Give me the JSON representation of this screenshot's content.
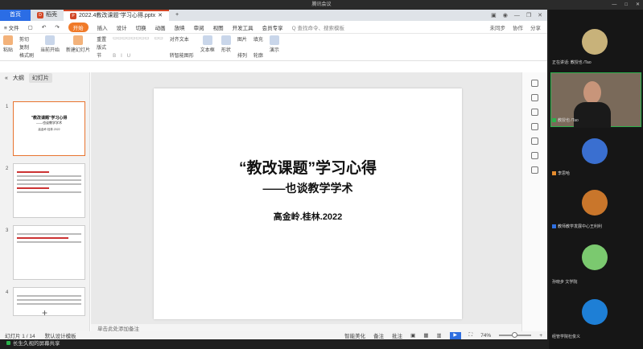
{
  "window": {
    "title": "腾讯会议",
    "controls": [
      "—",
      "□",
      "✕"
    ]
  },
  "tabs": {
    "home": "首页",
    "wps": "稻壳",
    "file": "2022.4教改课题\"学习心得.pptx",
    "add": "+"
  },
  "menu": {
    "file": "≡ 文件",
    "items": [
      "开始",
      "插入",
      "设计",
      "切换",
      "动画",
      "放映",
      "审阅",
      "视图",
      "开发工具",
      "会员专享"
    ],
    "search": "Q 查找命令、搜索模板",
    "sync": "未同步",
    "collab": "协作",
    "share": "分享"
  },
  "ribbon": {
    "paste": "粘贴",
    "cut": "剪切",
    "copy": "复制",
    "format": "格式刷",
    "from_current": "当前开始",
    "new_slide": "新建幻灯片",
    "layout": "版式",
    "section": "节",
    "reset": "重置",
    "bold": "B",
    "italic": "I",
    "underline": "U",
    "textbox": "文本框",
    "shape": "形状",
    "arrange": "排列",
    "picture": "图片",
    "fill": "填充",
    "outline": "轮廓",
    "present": "演示",
    "align_text": "对齐文本",
    "convert_smart": "转智能图形"
  },
  "panel": {
    "outline_tab": "大纲",
    "slides_tab": "幻灯片",
    "add": "+"
  },
  "thumbs": [
    {
      "num": "1",
      "title": "\"教改课题\"学习心得",
      "sub": "——也谈教学学术",
      "author": "高金岭.桂林.2022"
    },
    {
      "num": "2"
    },
    {
      "num": "3"
    },
    {
      "num": "4"
    }
  ],
  "slide": {
    "title": "“教改课题”学习心得",
    "subtitle": "——也谈教学学术",
    "author": "高金岭.桂林.2022"
  },
  "notes": "单击此处添加备注",
  "status": {
    "slide_count": "幻灯片 1 / 14",
    "template": "默认设计模板",
    "smart": "智能美化",
    "notes_btn": "备注",
    "annotate": "批注",
    "zoom": "74%"
  },
  "share_bar": "长生久视的屏幕共享",
  "meeting": {
    "speaking": "正在讲话: 教授也 /Tao",
    "participants": [
      {
        "name": "教授也 /Tao"
      },
      {
        "name": "李思哈"
      },
      {
        "name": "教师教学发展中心王利利"
      },
      {
        "name": "孙晓步 文学院"
      },
      {
        "name": "经管学院杜俊义"
      }
    ]
  }
}
